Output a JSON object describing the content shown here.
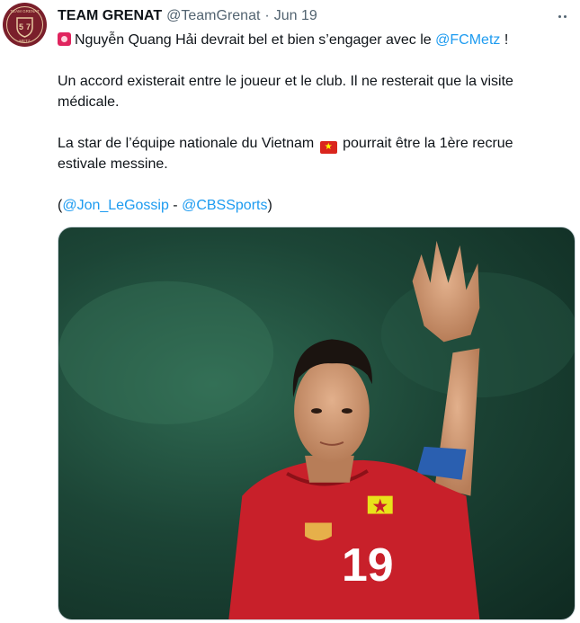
{
  "tweet": {
    "author_name": "TEAM GRENAT",
    "handle": "@TeamGrenat",
    "separator": "·",
    "date": "Jun 19",
    "line1_text": "Nguyễn Quang Hải devrait bel et bien s’engager avec le ",
    "line1_mention": "@FCMetz",
    "line1_end": " !",
    "para2": "Un accord existerait entre le joueur et le club. Il ne resterait que la visite médicale.",
    "para3_a": "La star de l’équipe nationale du Vietnam ",
    "para3_b": " pourrait être la 1ère recrue estivale messine.",
    "source_open": "(",
    "source_mention1": "@Jon_LeGossip",
    "source_sep": " - ",
    "source_mention2": "@CBSSports",
    "source_close": ")"
  },
  "avatar": {
    "top_text": "TEAM GRENAT",
    "bottom_text": "METZ"
  },
  "media": {
    "jersey_number": "19"
  },
  "icons": [
    "siren-icon",
    "vietnam-flag-icon",
    "more-icon"
  ],
  "colors": {
    "link": "#1d9bf0",
    "secondary_text": "#536471",
    "jersey_red": "#c8202a"
  }
}
